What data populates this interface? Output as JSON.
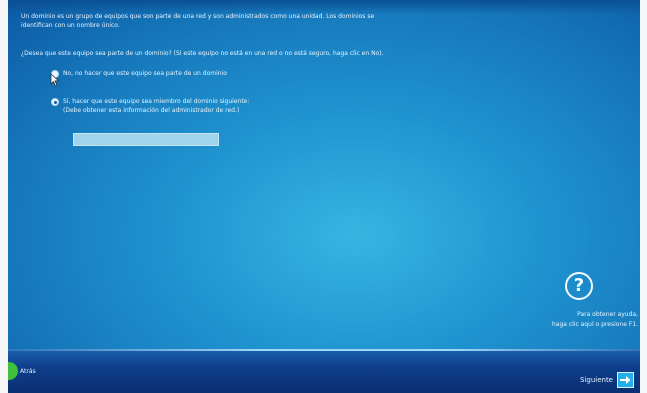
{
  "intro": {
    "line1": "Un dominio es un grupo de equipos que son parte de una red y son administrados como una unidad. Los dominios se",
    "line2": "identifican con un nombre único."
  },
  "question": {
    "text": "¿Desea que este equipo sea parte de un dominio? (Si este equipo no está en una red o no está seguro, haga clic en No)."
  },
  "options": {
    "no_label": "No, no hacer que este equipo sea parte de un dominio",
    "yes_label": "Sí, hacer que este equipo sea miembro del dominio siguiente:",
    "yes_note": "(Debe obtener esta información del administrador de red.)"
  },
  "domain_input": {
    "value": ""
  },
  "help": {
    "icon_glyph": "?",
    "line1": "Para obtener ayuda,",
    "line2": "haga clic aquí o presione F1."
  },
  "nav": {
    "back_label": "Atrás",
    "next_label": "Siguiente"
  },
  "colors": {
    "background": "#1f93cf",
    "bottom_bar": "#0f3f8c",
    "back_icon": "#3fbf3a",
    "next_icon": "#23b0e8"
  }
}
